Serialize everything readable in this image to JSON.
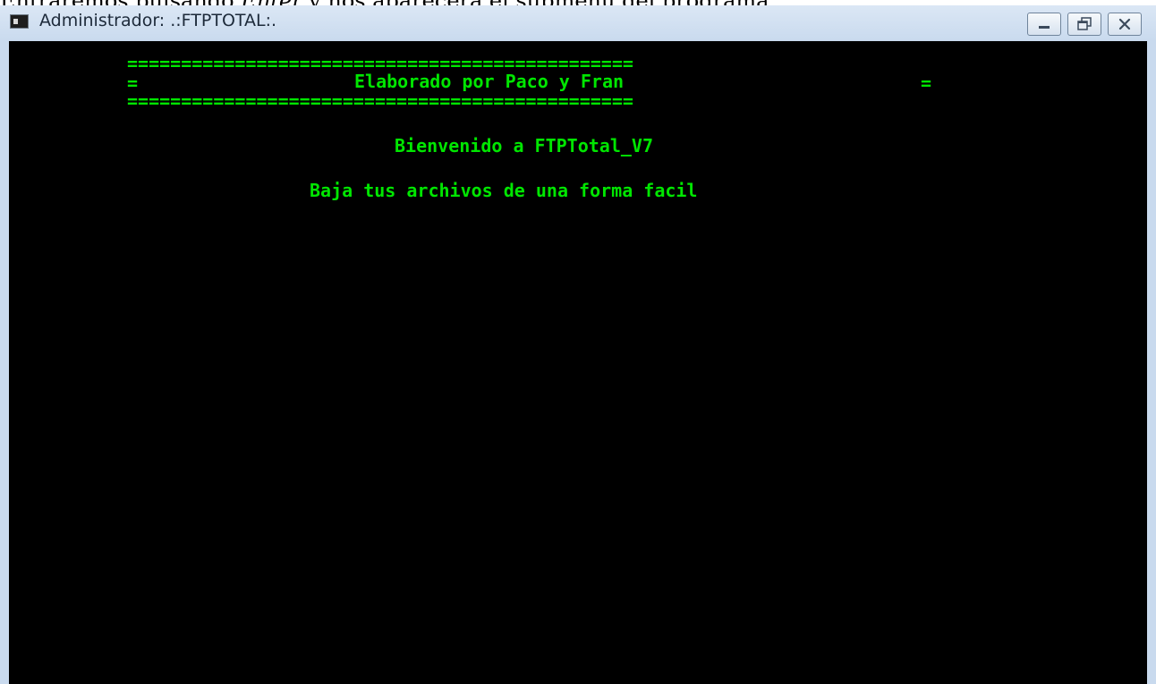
{
  "document_text": {
    "before": "Entraremos pulsando ",
    "emphasis": "Enter",
    "after": " y nos aparecerá el submenú del programa."
  },
  "window": {
    "title": "Administrador:  .:FTPTOTAL:.",
    "controls": [
      "minimize",
      "restore",
      "close"
    ]
  },
  "console": {
    "border_line": "===============================================",
    "header_left": "=",
    "header_text": "Elaborado por Paco y Fran",
    "header_right": "=",
    "welcome": "Bienvenido a FTPTotal_V7",
    "tagline": "Baja tus archivos de una forma facil"
  },
  "colors": {
    "console_bg": "#000000",
    "console_text": "#00e600",
    "titlebar": "#c9daee"
  },
  "icons": {
    "app": "console-window-icon",
    "minimize": "minimize-icon",
    "restore": "restore-icon",
    "close": "close-icon"
  }
}
